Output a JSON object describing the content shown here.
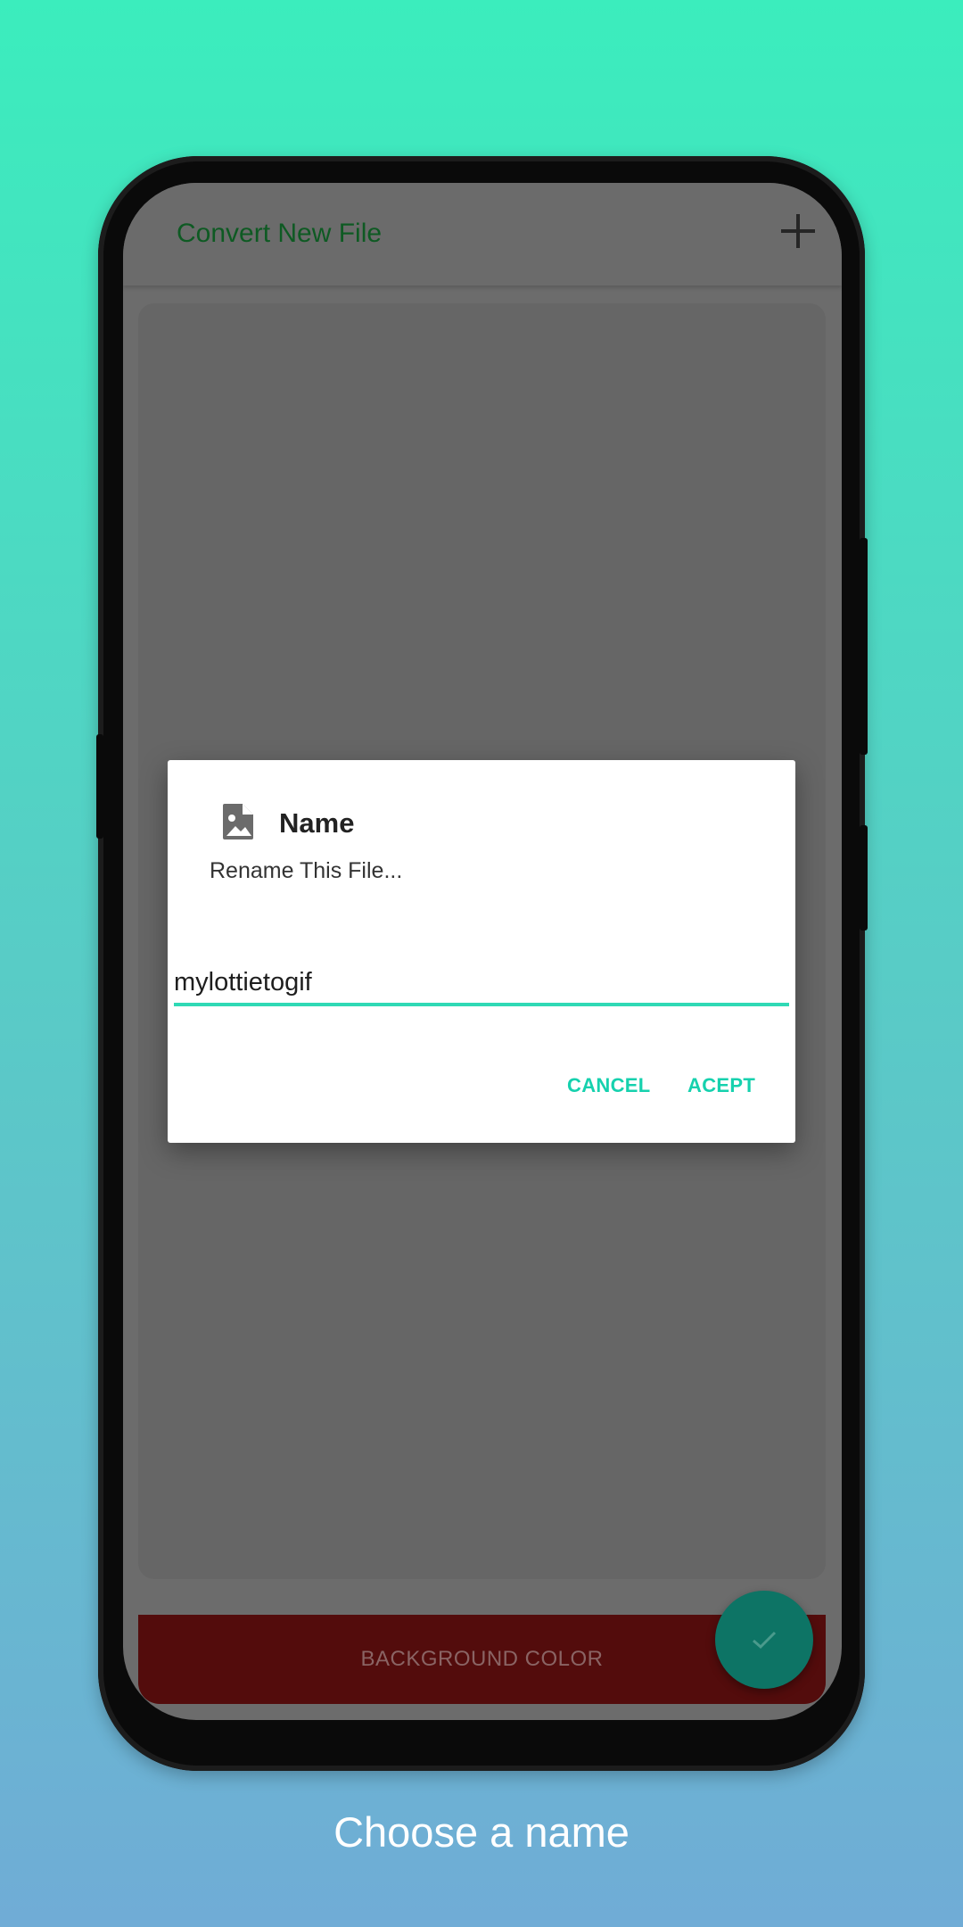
{
  "app": {
    "appbar_title": "Convert New File",
    "add_icon": "plus-icon",
    "background_color_button": "BACKGROUND COLOR",
    "fab_icon": "check-icon"
  },
  "dialog": {
    "icon": "image-file-icon",
    "title": "Name",
    "message": "Rename This File...",
    "input_value": "mylottietogif",
    "cancel_label": "CANCEL",
    "accept_label": "ACEPT"
  },
  "caption": "Choose a name",
  "colors": {
    "accent": "#2fd9b5",
    "appbar_title": "#0e5a23",
    "background_button": "#530c0c",
    "fab": "#0d7465"
  }
}
